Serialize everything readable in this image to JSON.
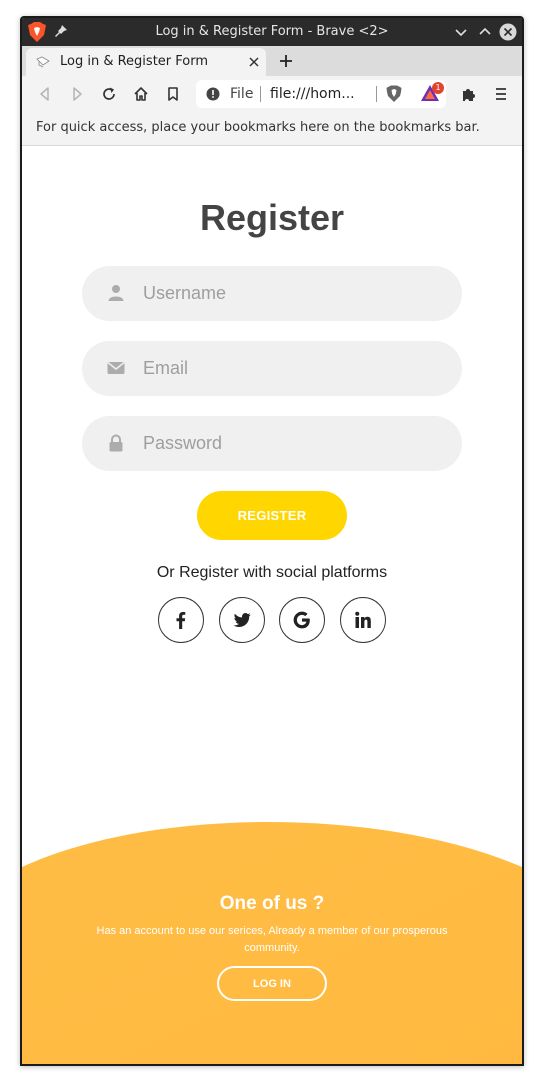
{
  "window": {
    "title": "Log in & Register Form - Brave <2>"
  },
  "tabs": [
    {
      "title": "Log in & Register Form"
    }
  ],
  "toolbar": {
    "scheme": "File",
    "url": "file:///hom...",
    "rewards_badge": "1"
  },
  "bookmarks": {
    "hint": "For quick access, place your bookmarks here on the bookmarks bar."
  },
  "form": {
    "title": "Register",
    "username_placeholder": "Username",
    "email_placeholder": "Email",
    "password_placeholder": "Password",
    "submit_label": "REGISTER",
    "social_text": "Or Register with social platforms",
    "social": [
      "facebook-icon",
      "twitter-icon",
      "google-icon",
      "linkedin-icon"
    ]
  },
  "panel": {
    "title": "One of us ?",
    "text": "Has an account to use our serices, Already a member of our prosperous community.",
    "button_label": "LOG IN"
  },
  "colors": {
    "accent_yellow": "#ffd600",
    "panel_orange": "#ffb93f",
    "titlebar": "#2b2b2b"
  }
}
